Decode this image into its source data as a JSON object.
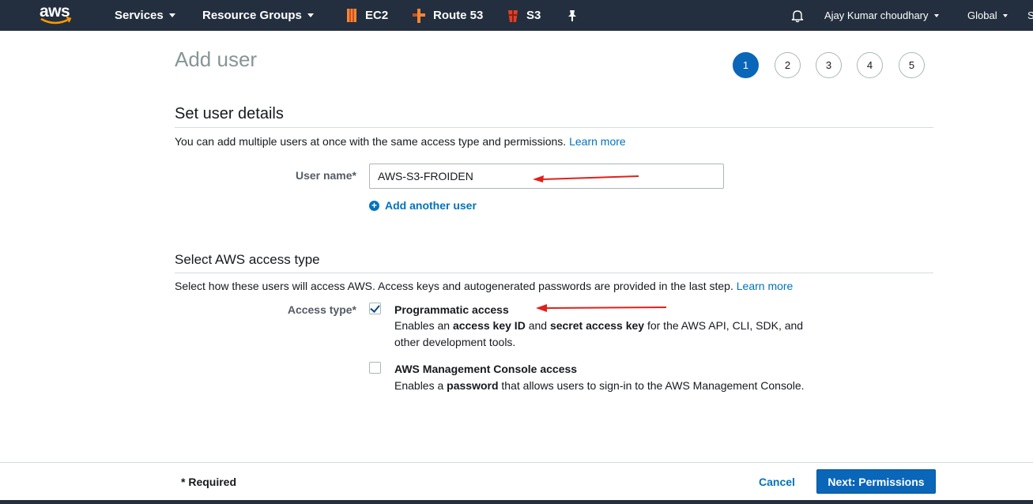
{
  "nav": {
    "logo": "aws",
    "services": "Services",
    "resource_groups": "Resource Groups",
    "ec2": "EC2",
    "route53": "Route 53",
    "s3": "S3",
    "user": "Ajay Kumar choudhary",
    "region": "Global",
    "more": "S"
  },
  "page": {
    "title": "Add user",
    "steps": [
      "1",
      "2",
      "3",
      "4",
      "5"
    ],
    "active_step": "1"
  },
  "user_details": {
    "title": "Set user details",
    "description": "You can add multiple users at once with the same access type and permissions.",
    "learn_more": "Learn more",
    "user_name_label": "User name*",
    "user_name_value": "AWS-S3-FROIDEN",
    "add_another": "Add another user"
  },
  "access_type": {
    "title": "Select AWS access type",
    "description": "Select how these users will access AWS. Access keys and autogenerated passwords are provided in the last step.",
    "learn_more": "Learn more",
    "label": "Access type*",
    "programmatic": {
      "title": "Programmatic access",
      "checked": true,
      "desc_1": "Enables an ",
      "desc_b1": "access key ID",
      "desc_2": " and ",
      "desc_b2": "secret access key",
      "desc_3": " for the AWS API, CLI, SDK, and other development tools."
    },
    "console": {
      "title": "AWS Management Console access",
      "checked": false,
      "desc_1": "Enables a ",
      "desc_b1": "password",
      "desc_2": " that allows users to sign-in to the AWS Management Console."
    }
  },
  "footer": {
    "required": "* Required",
    "cancel": "Cancel",
    "next": "Next: Permissions"
  },
  "colors": {
    "nav_bg": "#232f3e",
    "primary": "#0a66b8",
    "link": "#0073bb",
    "annotation": "#e0201b",
    "aws_orange": "#ff9900",
    "s3_red": "#e0402a"
  }
}
